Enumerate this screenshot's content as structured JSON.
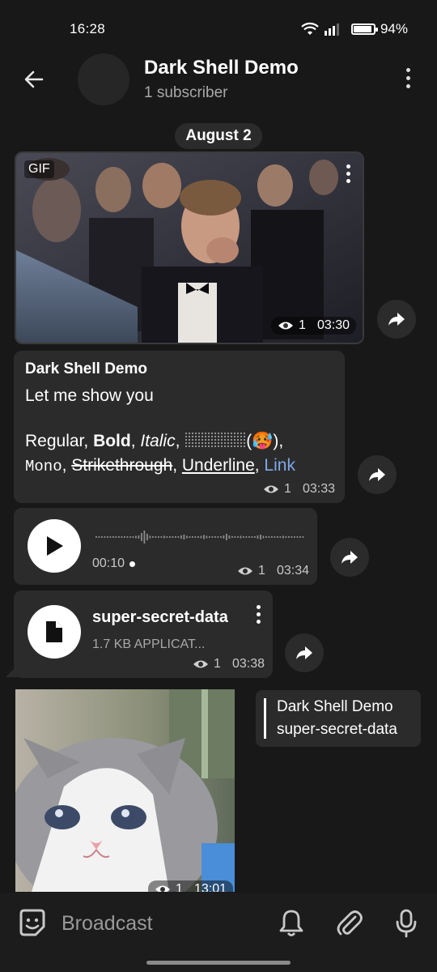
{
  "status": {
    "time": "16:28",
    "battery": "94%"
  },
  "channel": {
    "title": "Dark Shell Demo",
    "subscribers": "1 subscriber"
  },
  "date_chip": "August 2",
  "gif_msg": {
    "tag": "GIF",
    "views": "1",
    "time": "03:30"
  },
  "text_msg": {
    "sender": "Dark Shell Demo",
    "line1": "Let me show you",
    "regular": "Regular, ",
    "bold": "Bold",
    "comma1": ", ",
    "italic": "Italic",
    "comma2": ", ",
    "emoji": "(🥵),",
    "mono": "Mono",
    "comma3": ", ",
    "strike": "Strikethrough",
    "comma4": ", ",
    "underline": "Underline",
    "comma5": ", ",
    "link": "Link",
    "views": "1",
    "time": "03:33"
  },
  "voice_msg": {
    "duration": "00:10",
    "views": "1",
    "time": "03:34"
  },
  "file_msg": {
    "name": "super-secret-data",
    "size": "1.7 KB APPLICAT...",
    "views": "1",
    "time": "03:38"
  },
  "sticker_msg": {
    "views": "1",
    "time": "13:01"
  },
  "reply": {
    "name": "Dark Shell Demo",
    "text": "super-secret-data"
  },
  "input": {
    "placeholder": "Broadcast"
  }
}
